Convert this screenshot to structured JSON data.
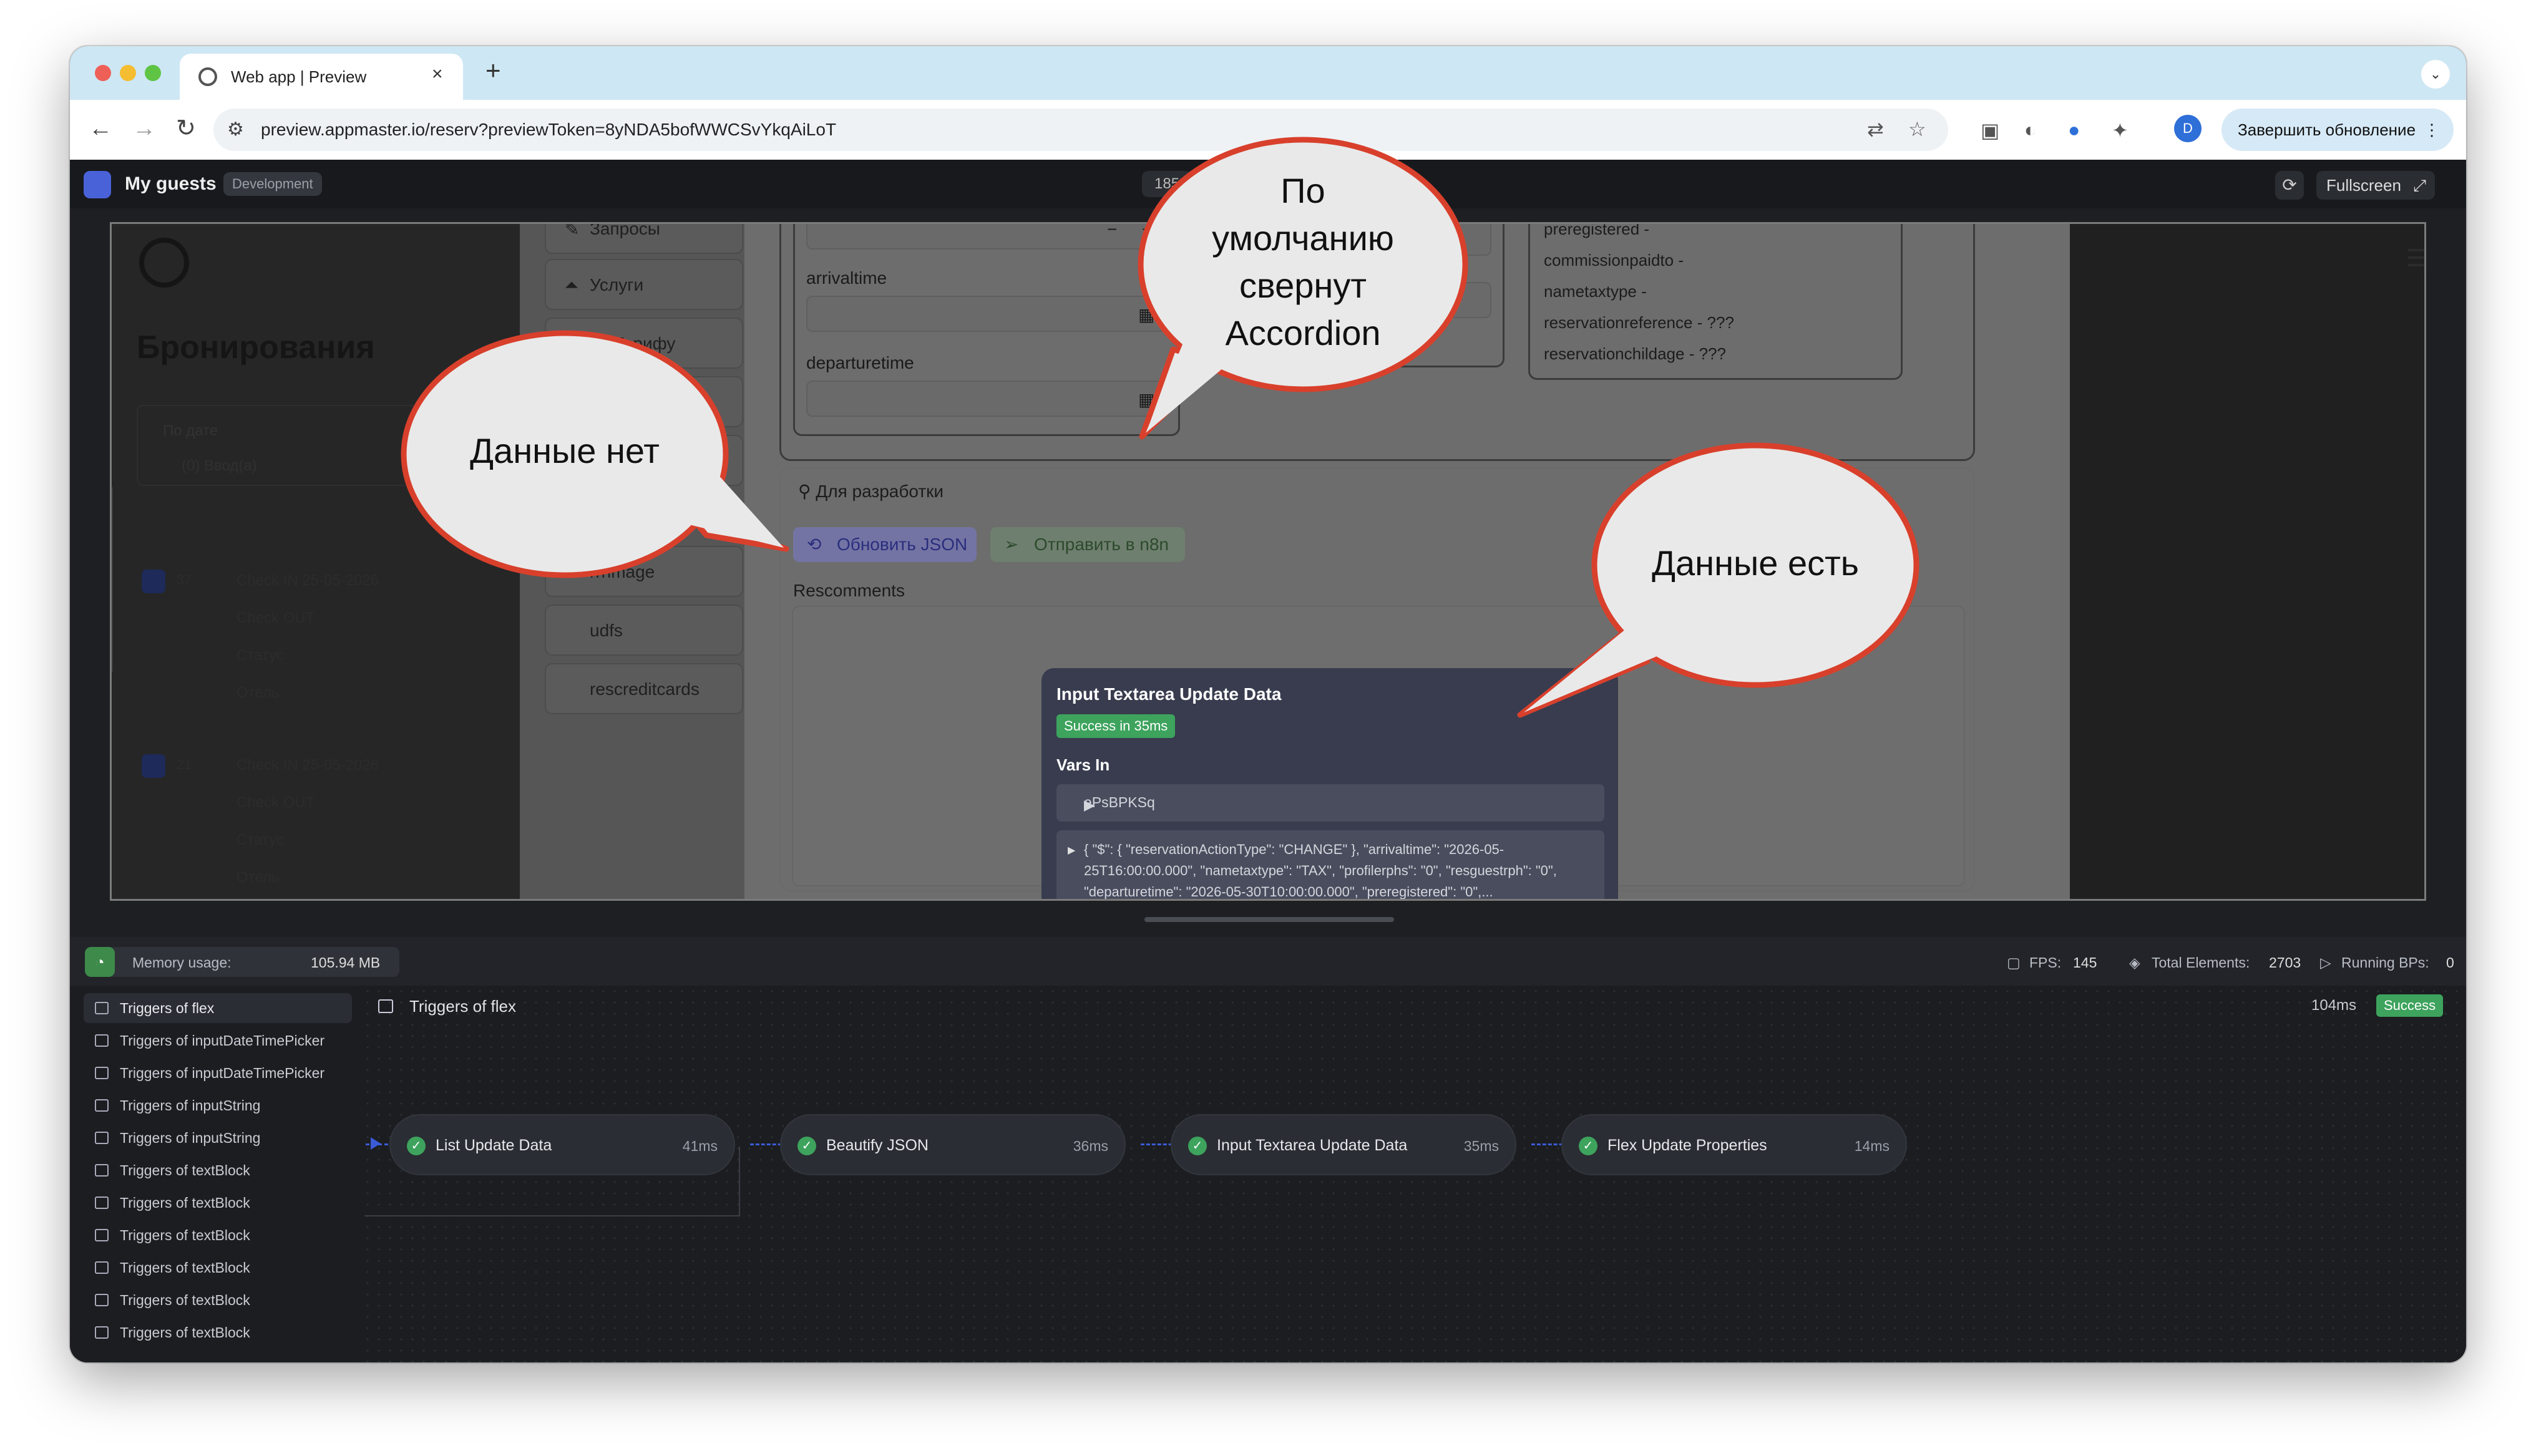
{
  "browser": {
    "tab_title": "Web app | Preview",
    "tab_close": "×",
    "new_tab": "+",
    "tabs_menu": "⌄",
    "url": "preview.appmaster.io/reserv?previewToken=8yNDA5bofWWCSvYkqAiLoT",
    "profile_initial": "D",
    "update_button": "Завершить обновление",
    "update_menu": "⋮"
  },
  "app_header": {
    "app_name": "My guests",
    "env_badge": "Development",
    "center_number": "185",
    "fullscreen_label": "Fullscreen"
  },
  "preview": {
    "booking_title": "Бронирования",
    "filter_label": "По дате",
    "filter_value": "(0) Ввод(а)",
    "cards": [
      {
        "num": "37",
        "rows": [
          "Check IN 25-05-2026",
          "Check OUT",
          "Статус",
          "Отель"
        ]
      },
      {
        "num": "21",
        "rows": [
          "Check IN 25-05-2026",
          "Check OUT",
          "Статус",
          "Отель"
        ]
      }
    ],
    "nav_items": [
      "Запросы",
      "Услуги",
      "Тарифу",
      "",
      "rrrimage",
      "udfs",
      "rescreditcards"
    ],
    "fields": {
      "arrival_label": "arrivaltime",
      "departure_label": "departuretime",
      "minus": "−",
      "plus": "+"
    },
    "right_box_lines": [
      "preregistered -",
      "commissionpaidto -",
      "nametaxtype -",
      "reservationreference - ???",
      "reservationchildage - ???"
    ],
    "dev_section_title": "Для разработки",
    "btn_update_json": "Обновить JSON",
    "btn_send_n8n": "Отправить в n8n",
    "rescomments_label": "Rescomments"
  },
  "tooltip": {
    "title": "Input Textarea Update Data",
    "badge": "Success in 35ms",
    "vars_in": "Vars In",
    "var1": "ePsBPKSq",
    "var2": "{ \"$\": { \"reservationActionType\": \"CHANGE\" }, \"arrivaltime\": \"2026-05-25T16:00:00.000\", \"nametaxtype\": \"TAX\", \"profilerphs\": \"0\", \"resguestrph\": \"0\", \"departuretime\": \"2026-05-30T10:00:00.000\", \"preregistered\": \"0\",..."
  },
  "status_bar": {
    "memory_label": "Memory usage:",
    "memory_value": "105.94 MB",
    "fps_label": "FPS:",
    "fps_value": "145",
    "total_label": "Total Elements:",
    "total_value": "2703",
    "running_label": "Running BPs:",
    "running_value": "0"
  },
  "debugger": {
    "triggers": [
      "Triggers of flex",
      "Triggers of inputDateTimePicker",
      "Triggers of inputDateTimePicker",
      "Triggers of inputString",
      "Triggers of inputString",
      "Triggers of textBlock",
      "Triggers of textBlock",
      "Triggers of textBlock",
      "Triggers of textBlock",
      "Triggers of textBlock",
      "Triggers of textBlock"
    ],
    "title": "Triggers of flex",
    "total_ms": "104ms",
    "status": "Success",
    "nodes": [
      {
        "name": "List Update Data",
        "ms": "41ms"
      },
      {
        "name": "Beautify JSON",
        "ms": "36ms"
      },
      {
        "name": "Input Textarea Update Data",
        "ms": "35ms"
      },
      {
        "name": "Flex Update Properties",
        "ms": "14ms"
      }
    ]
  },
  "callouts": {
    "no_data": "Данные нет",
    "has_data": "Данные есть",
    "accordion": [
      "По",
      "умолчанию",
      "свернут",
      "Accordion"
    ]
  },
  "colors": {
    "tab_strip": "#cde7f4",
    "success": "#3da35d",
    "connector": "#3b5bd8",
    "callout_fill": "#e9e9e9",
    "callout_border": "#d8402c"
  }
}
